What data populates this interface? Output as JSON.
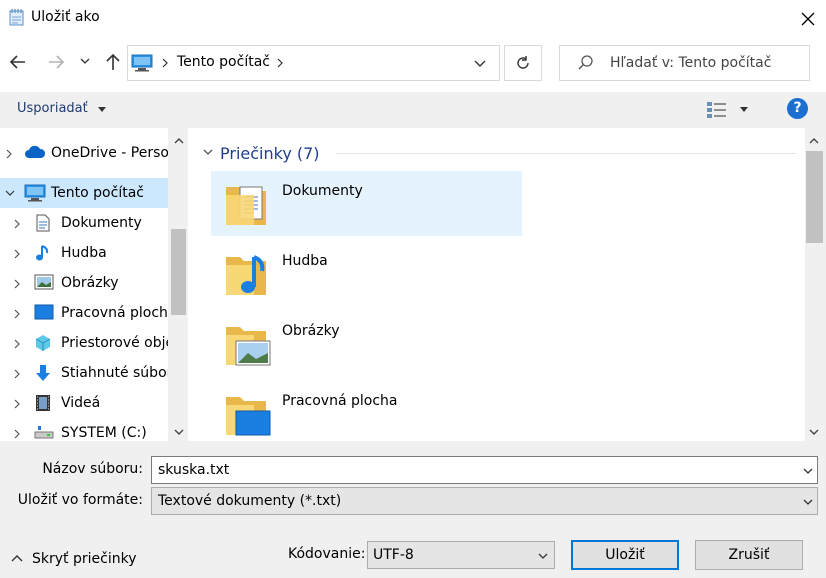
{
  "window": {
    "title": "Uložiť ako"
  },
  "address": {
    "location": "Tento počítač"
  },
  "search": {
    "placeholder": "Hľadať v: Tento počítač"
  },
  "toolbar": {
    "organize_label": "Usporiadať",
    "help_label": "?"
  },
  "nav": {
    "items": [
      {
        "label": "OneDrive - Personal",
        "icon": "onedrive-cloud-icon",
        "selected": false,
        "expanded": false
      },
      {
        "label": "Tento počítač",
        "icon": "computer-icon",
        "selected": true,
        "expanded": true
      },
      {
        "label": "Dokumenty",
        "icon": "documents-icon",
        "selected": false,
        "expanded": false
      },
      {
        "label": "Hudba",
        "icon": "music-icon",
        "selected": false,
        "expanded": false
      },
      {
        "label": "Obrázky",
        "icon": "pictures-icon",
        "selected": false,
        "expanded": false
      },
      {
        "label": "Pracovná plocha",
        "icon": "desktop-icon",
        "selected": false,
        "expanded": false
      },
      {
        "label": "Priestorové objekty",
        "icon": "3d-objects-icon",
        "selected": false,
        "expanded": false
      },
      {
        "label": "Stiahnuté súbory",
        "icon": "downloads-icon",
        "selected": false,
        "expanded": false
      },
      {
        "label": "Videá",
        "icon": "videos-icon",
        "selected": false,
        "expanded": false
      },
      {
        "label": "SYSTEM (C:)",
        "icon": "drive-icon",
        "selected": false,
        "expanded": false
      }
    ]
  },
  "main": {
    "group_label": "Priečinky (7)",
    "folders": [
      {
        "label": "Dokumenty",
        "icon": "documents-folder-icon",
        "selected": true
      },
      {
        "label": "Hudba",
        "icon": "music-folder-icon",
        "selected": false
      },
      {
        "label": "Obrázky",
        "icon": "pictures-folder-icon",
        "selected": false
      },
      {
        "label": "Pracovná plocha",
        "icon": "desktop-folder-icon",
        "selected": false
      }
    ]
  },
  "form": {
    "filename_label": "Názov súboru:",
    "filename_value": "skuska.txt",
    "format_label": "Uložiť vo formáte:",
    "format_value": "Textové dokumenty (*.txt)",
    "encoding_label": "Kódovanie:",
    "encoding_value": "UTF-8",
    "hide_folders_label": "Skryť priečinky",
    "save_label": "Uložiť",
    "cancel_label": "Zrušiť"
  },
  "colors": {
    "accent": "#0078d7",
    "selection": "#cce8ff",
    "tile_selection": "#e5f3ff",
    "group_header": "#1e3f8c"
  }
}
